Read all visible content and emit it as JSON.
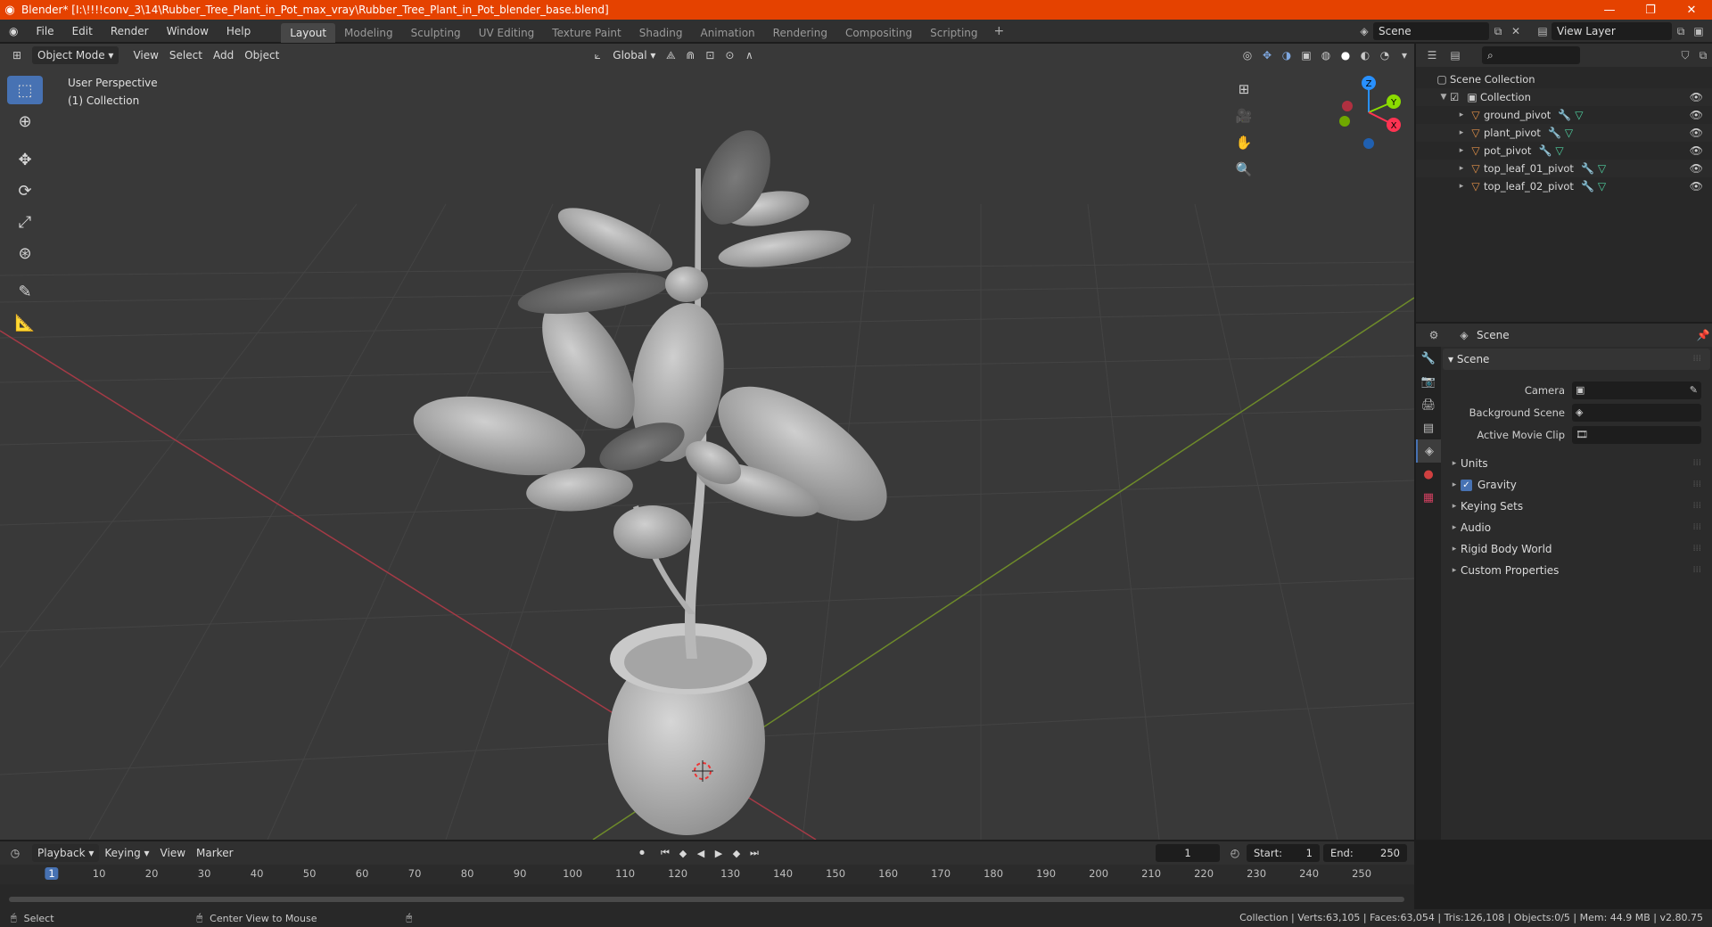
{
  "window": {
    "title": "Blender* [I:\\!!!!conv_3\\14\\Rubber_Tree_Plant_in_Pot_max_vray\\Rubber_Tree_Plant_in_Pot_blender_base.blend]",
    "controls": [
      "—",
      "❐",
      "✕"
    ]
  },
  "menu": [
    "File",
    "Edit",
    "Render",
    "Window",
    "Help"
  ],
  "workspaces": [
    {
      "label": "Layout",
      "active": true
    },
    {
      "label": "Modeling"
    },
    {
      "label": "Sculpting"
    },
    {
      "label": "UV Editing"
    },
    {
      "label": "Texture Paint"
    },
    {
      "label": "Shading"
    },
    {
      "label": "Animation"
    },
    {
      "label": "Rendering"
    },
    {
      "label": "Compositing"
    },
    {
      "label": "Scripting"
    }
  ],
  "scene_selector": "Scene",
  "view_layer_selector": "View Layer",
  "viewport": {
    "mode": "Object Mode",
    "menus": [
      "View",
      "Select",
      "Add",
      "Object"
    ],
    "transform_orientation": "Global",
    "info_line1": "User Perspective",
    "info_line2": "(1) Collection",
    "gizmo_axes": {
      "x": "X",
      "y": "Y",
      "z": "Z"
    }
  },
  "outliner": {
    "root": "Scene Collection",
    "collection": "Collection",
    "objects": [
      "ground_pivot",
      "plant_pivot",
      "pot_pivot",
      "top_leaf_01_pivot",
      "top_leaf_02_pivot"
    ]
  },
  "properties": {
    "header": "Scene",
    "panel_title": "Scene",
    "rows": [
      {
        "label": "Camera"
      },
      {
        "label": "Background Scene"
      },
      {
        "label": "Active Movie Clip"
      }
    ],
    "subpanels": {
      "units": "Units",
      "gravity": "Gravity",
      "keying_sets": "Keying Sets",
      "audio": "Audio",
      "rigid_body": "Rigid Body World",
      "custom_props": "Custom Properties"
    }
  },
  "timeline": {
    "menus": [
      "Playback",
      "Keying",
      "View",
      "Marker"
    ],
    "current_frame": "1",
    "start_label": "Start:",
    "start": "1",
    "end_label": "End:",
    "end": "250",
    "ticks": [
      "1",
      "10",
      "20",
      "30",
      "40",
      "50",
      "60",
      "70",
      "80",
      "90",
      "100",
      "110",
      "120",
      "130",
      "140",
      "150",
      "160",
      "170",
      "180",
      "190",
      "200",
      "210",
      "220",
      "230",
      "240",
      "250"
    ]
  },
  "status": {
    "left": "Select",
    "middle": "Center View to Mouse",
    "stats": "Collection | Verts:63,105 | Faces:63,054 | Tris:126,108 | Objects:0/5 | Mem: 44.9 MB | v2.80.75"
  },
  "colors": {
    "accent": "#4772b3",
    "titlebar": "#e54200",
    "x_axis": "#ff3352",
    "y_axis": "#8bdc00",
    "z_axis": "#2890ff"
  }
}
